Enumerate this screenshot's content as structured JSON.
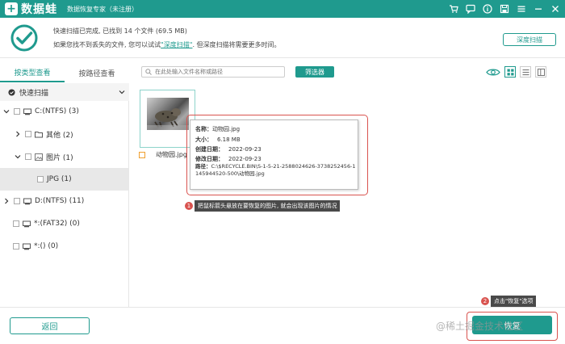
{
  "app": {
    "logo_mark": "+",
    "name": "数据蛙",
    "subtitle": "数据恢复专家（未注册）"
  },
  "titlebar_icons": [
    "cart-icon",
    "chat-icon",
    "info-icon",
    "save-icon",
    "menu-icon",
    "minimize-icon",
    "close-icon"
  ],
  "scan": {
    "line1": "快速扫描已完成, 已找到 14 个文件 (69.5 MB)",
    "line2_prefix": "如果您找不到丢失的文件, 您可以试试",
    "deep_link": "\"深度扫描\"",
    "line2_suffix": ". 但深度扫描将需要更多时间。",
    "deep_button": "深度扫描"
  },
  "tabs": [
    {
      "label": "按类型查看",
      "active": true
    },
    {
      "label": "按路径查看",
      "active": false
    }
  ],
  "tree": {
    "header": "快速扫描",
    "items": [
      {
        "label": "C:(NTFS) (3)"
      },
      {
        "label": "其他 (2)"
      },
      {
        "label": "图片 (1)"
      },
      {
        "label": "JPG (1)"
      },
      {
        "label": "D:(NTFS) (11)"
      },
      {
        "label": "*:(FAT32) (0)"
      },
      {
        "label": "*:() (0)"
      }
    ]
  },
  "toolbar": {
    "search_placeholder": "在此处输入文件名称或路径",
    "filter_button": "筛选器"
  },
  "file": {
    "name": "动物园.jpg"
  },
  "tooltip": {
    "name_key": "名称：",
    "name_val": "动物园.jpg",
    "size_key": "大小：",
    "size_val": "6.18 MB",
    "created_key": "创建日期：",
    "created_val": "2022-09-23",
    "modified_key": "修改日期：",
    "modified_val": "2022-09-23",
    "path_key": "路径：",
    "path_val": "C:\\$RECYCLE.BIN\\S-1-5-21-2588024626-3738252456-1145944520-500\\动物园.jpg"
  },
  "hints": {
    "hint1_num": "1",
    "hint1_text": "把鼠标箭头悬放在要恢复的图片, 就会出现该图片的情况",
    "hint2_num": "2",
    "hint2_text": "点击\"恢复\"选项"
  },
  "footer": {
    "back_button": "返回",
    "recover_button": "恢复",
    "watermark": "@稀土掘金技术社区"
  },
  "colors": {
    "brand": "#1f9a8e",
    "highlight": "#d9534f"
  }
}
